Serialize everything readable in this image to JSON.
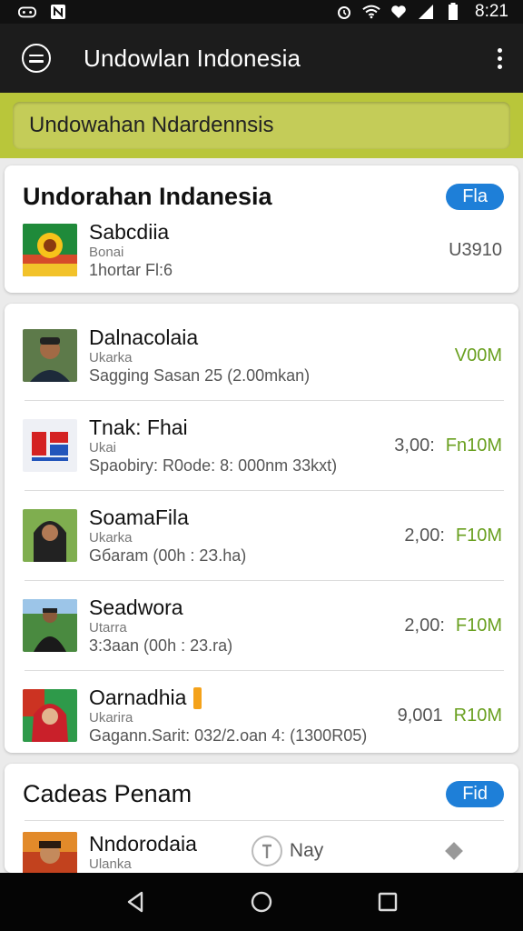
{
  "status": {
    "time": "8:21"
  },
  "app_bar": {
    "title": "Undowlan Indonesia"
  },
  "banner": {
    "text": "Undowahan Ndardennsis"
  },
  "card1": {
    "title": "Undorahan Indanesia",
    "pill": "Fla",
    "row": {
      "name": "Sabcdiia",
      "sub": "Bonai",
      "detail": "1hortar Fl:6",
      "right": "U3910"
    }
  },
  "card2": {
    "rows": [
      {
        "name": "Dalnacolaia",
        "sub": "Ukarka",
        "detail": "Sagging Sasan 25 (2.00mkan)",
        "amount": "",
        "value": "V00M"
      },
      {
        "name": "Tnak: Fhai",
        "sub": "Ukai",
        "detail": "Spaobiry: R0ode: 8: 000nm 33kxt)",
        "amount": "3,00:",
        "value": "Fn10M"
      },
      {
        "name": "SoamaFila",
        "sub": "Ukarka",
        "detail": "Gбaram (00h : 2З.hа)",
        "amount": "2,00:",
        "value": "F10M"
      },
      {
        "name": "Seadwora",
        "sub": "Utarra",
        "detail": "3:3aan (00h : 23.ra)",
        "amount": "2,00:",
        "value": "F10M"
      },
      {
        "name": "Oarnadhia",
        "sub": "Ukarira",
        "detail": "Gagann.Sarit: 032/2.oan 4: (1300R05)",
        "amount": "9,001",
        "value": "R10M"
      }
    ]
  },
  "card3": {
    "title": "Cadeas Penam",
    "pill": "Fid",
    "row": {
      "name": "Nndorodaia",
      "sub": "Ulanka",
      "nav_label": "Nay"
    }
  },
  "colors": {
    "accent_green": "#6aa020",
    "pill_blue": "#1e7fd8",
    "banner_lime": "#c4cc58"
  }
}
